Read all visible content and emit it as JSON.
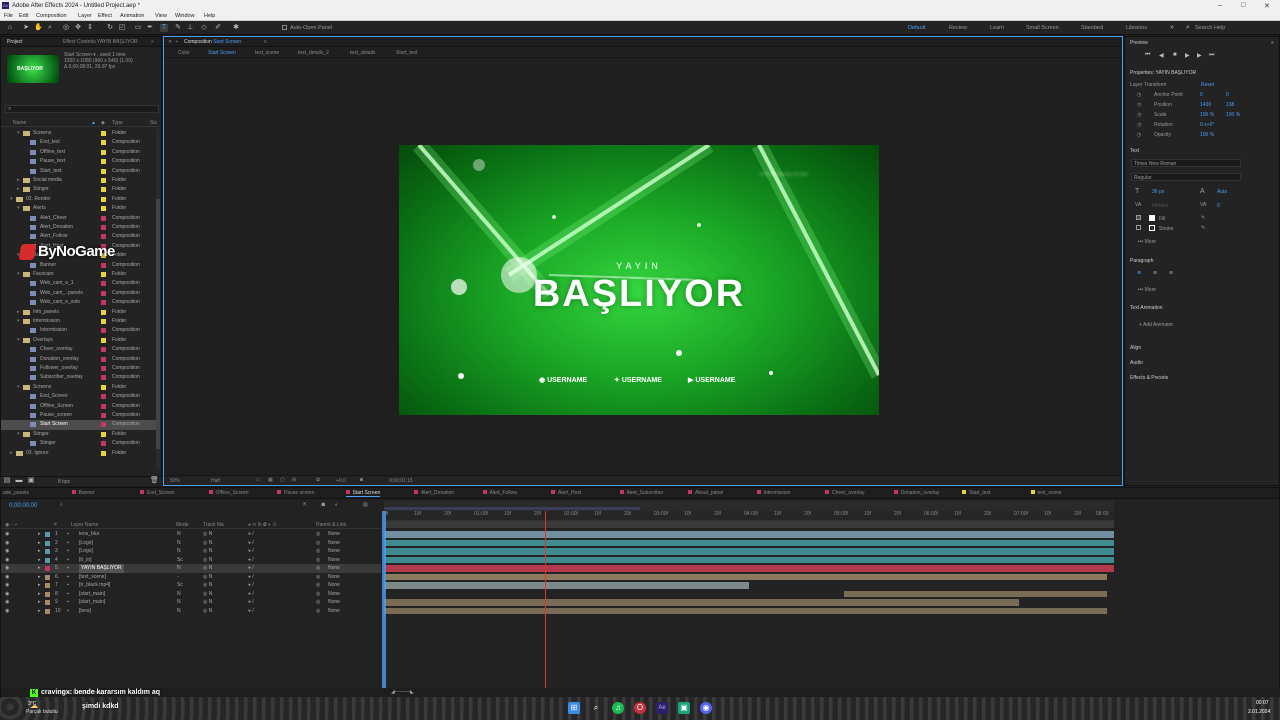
{
  "window": {
    "title": "Adobe After Effects 2024 - Untitled Project.aep *",
    "controls": [
      "–",
      "□",
      "✕"
    ]
  },
  "menu": [
    "File",
    "Edit",
    "Composition",
    "Layer",
    "Effect",
    "Animation",
    "View",
    "Window",
    "Help"
  ],
  "toolbar": {
    "auto_open": "Auto-Open Panel",
    "workspaces": [
      {
        "label": "Default",
        "active": true
      },
      {
        "label": "Review",
        "active": false
      },
      {
        "label": "Learn",
        "active": false
      },
      {
        "label": "Small Screen",
        "active": false
      },
      {
        "label": "Standard",
        "active": false
      },
      {
        "label": "Libraries",
        "active": false
      }
    ],
    "search_help": "Search Help"
  },
  "project": {
    "tabs": {
      "project": "Project",
      "effect_controls": "Effect Controls YAYIN BAŞLIYOR"
    },
    "thumb_text": "BAŞLIYOR",
    "info": [
      "Start Screen ▾ , used 1 time",
      "1920 x 1080 (960 x 540) (1.00)",
      "Δ 0;00;08;01, 29.97 fps"
    ],
    "columns": {
      "name": "Name",
      "type": "Type",
      "size": "Siz"
    },
    "rows": [
      {
        "indent": 2,
        "kind": "folder",
        "name": "Screens",
        "type": "Folder",
        "color": "#e7d33b",
        "open": true
      },
      {
        "indent": 3,
        "kind": "comp",
        "name": "End_text",
        "type": "Composition",
        "color": "#e7d33b"
      },
      {
        "indent": 3,
        "kind": "comp",
        "name": "Offline_text",
        "type": "Composition",
        "color": "#e7d33b"
      },
      {
        "indent": 3,
        "kind": "comp",
        "name": "Pause_text",
        "type": "Composition",
        "color": "#e7d33b"
      },
      {
        "indent": 3,
        "kind": "comp",
        "name": "Start_text",
        "type": "Composition",
        "color": "#e7d33b"
      },
      {
        "indent": 2,
        "kind": "folder",
        "name": "Social media",
        "type": "Folder",
        "color": "#e7d33b"
      },
      {
        "indent": 2,
        "kind": "folder",
        "name": "Stinger",
        "type": "Folder",
        "color": "#e7d33b"
      },
      {
        "indent": 1,
        "kind": "folder",
        "name": "02. Render",
        "type": "Folder",
        "color": "#e7d33b",
        "open": true
      },
      {
        "indent": 2,
        "kind": "folder",
        "name": "Alerts",
        "type": "Folder",
        "color": "#e7d33b",
        "open": true
      },
      {
        "indent": 3,
        "kind": "comp",
        "name": "Alert_Cheer",
        "type": "Composition",
        "color": "#c5356b"
      },
      {
        "indent": 3,
        "kind": "comp",
        "name": "Alert_Donation",
        "type": "Composition",
        "color": "#c5356b"
      },
      {
        "indent": 3,
        "kind": "comp",
        "name": "Alert_Follow",
        "type": "Composition",
        "color": "#c5356b"
      },
      {
        "indent": 3,
        "kind": "comp",
        "name": "Alert_Host",
        "type": "Composition",
        "color": "#c5356b"
      },
      {
        "indent": 2,
        "kind": "folder",
        "name": "Banner",
        "type": "Folder",
        "color": "#e7d33b",
        "open": true
      },
      {
        "indent": 3,
        "kind": "comp",
        "name": "Banner",
        "type": "Composition",
        "color": "#c5356b"
      },
      {
        "indent": 2,
        "kind": "folder",
        "name": "Facecam",
        "type": "Folder",
        "color": "#e7d33b",
        "open": true
      },
      {
        "indent": 3,
        "kind": "comp",
        "name": "Web_cam_e_1",
        "type": "Composition",
        "color": "#c5356b"
      },
      {
        "indent": 3,
        "kind": "comp",
        "name": "Web_cam_..panels",
        "type": "Composition",
        "color": "#c5356b"
      },
      {
        "indent": 3,
        "kind": "comp",
        "name": "Web_cam_e_solo",
        "type": "Composition",
        "color": "#c5356b"
      },
      {
        "indent": 2,
        "kind": "folder",
        "name": "Info_panels",
        "type": "Folder",
        "color": "#e7d33b"
      },
      {
        "indent": 2,
        "kind": "folder",
        "name": "Intermission",
        "type": "Folder",
        "color": "#e7d33b",
        "open": true
      },
      {
        "indent": 3,
        "kind": "comp",
        "name": "Intermission",
        "type": "Composition",
        "color": "#c5356b"
      },
      {
        "indent": 2,
        "kind": "folder",
        "name": "Overlays",
        "type": "Folder",
        "color": "#e7d33b",
        "open": true
      },
      {
        "indent": 3,
        "kind": "comp",
        "name": "Cheer_overlay",
        "type": "Composition",
        "color": "#c5356b"
      },
      {
        "indent": 3,
        "kind": "comp",
        "name": "Donation_overlay",
        "type": "Composition",
        "color": "#c5356b"
      },
      {
        "indent": 3,
        "kind": "comp",
        "name": "Follower_overlay",
        "type": "Composition",
        "color": "#c5356b"
      },
      {
        "indent": 3,
        "kind": "comp",
        "name": "Subscriber_overlay",
        "type": "Composition",
        "color": "#c5356b"
      },
      {
        "indent": 2,
        "kind": "folder",
        "name": "Screens",
        "type": "Folder",
        "color": "#e7d33b",
        "open": true
      },
      {
        "indent": 3,
        "kind": "comp",
        "name": "End_Screen",
        "type": "Composition",
        "color": "#c5356b"
      },
      {
        "indent": 3,
        "kind": "comp",
        "name": "Offline_Screen",
        "type": "Composition",
        "color": "#c5356b"
      },
      {
        "indent": 3,
        "kind": "comp",
        "name": "Pause_screen",
        "type": "Composition",
        "color": "#c5356b"
      },
      {
        "indent": 3,
        "kind": "comp",
        "name": "Start Screen",
        "type": "Composition",
        "color": "#c5356b",
        "selected": true
      },
      {
        "indent": 2,
        "kind": "folder",
        "name": "Stinger",
        "type": "Folder",
        "color": "#e7d33b",
        "open": true
      },
      {
        "indent": 3,
        "kind": "comp",
        "name": "Stinger",
        "type": "Composition",
        "color": "#c5356b"
      },
      {
        "indent": 1,
        "kind": "folder",
        "name": "03. Ignore",
        "type": "Folder",
        "color": "#e7d33b"
      }
    ],
    "bpc": "8 bpc"
  },
  "watermark": "ByNoGame",
  "composition": {
    "tab_label": "Composition",
    "tab_name": "Start Screen",
    "breadcrumbs": [
      "Color",
      "Start Screen",
      "text_scene",
      "text_details_2",
      "text_details",
      "Start_text"
    ],
    "preview": {
      "subtitle": "YAYIN",
      "title": "BAŞLIYOR",
      "socials": [
        "USERNAME",
        "USERNAME",
        "USERNAME"
      ],
      "corner_blur": "YAYIN BAŞLIYOR"
    },
    "footer": {
      "zoom": "50%",
      "resolution": "Half",
      "exposure": "+0.0",
      "timecode": "0;00;01;15"
    }
  },
  "right_panel": {
    "preview_label": "Preview",
    "properties_title": "Properties: YAYIN BAŞLIYOR",
    "layer_transform": "Layer Transform",
    "reset": "Reset",
    "transform": [
      {
        "label": "Anchor Point",
        "v1": "0",
        "v2": "0"
      },
      {
        "label": "Position",
        "v1": "1430",
        "v2": "138"
      },
      {
        "label": "Scale",
        "v1": "100 %",
        "v2": "100 %"
      },
      {
        "label": "Rotation",
        "v1": "0 x+0°",
        "v2": ""
      },
      {
        "label": "Opacity",
        "v1": "100 %",
        "v2": ""
      }
    ],
    "text_section": "Text",
    "font": "Times New Roman",
    "font_style": "Regular",
    "font_size": "36 px",
    "leading": "Auto",
    "kerning": "Metrics",
    "tracking": "0",
    "fill": "Fill",
    "stroke": "Stroke",
    "more": "More",
    "paragraph": "Paragraph",
    "text_animation": "Text Animation",
    "add_animator": "Add Animator",
    "align": "Align",
    "audio": "Audio",
    "effects_presets": "Effects & Presets"
  },
  "timeline": {
    "tabs": [
      {
        "label": "ade_panels",
        "color": "#999"
      },
      {
        "label": "Banner",
        "color": "#c5356b"
      },
      {
        "label": "End_Screen",
        "color": "#c5356b"
      },
      {
        "label": "Offline_Screen",
        "color": "#c5356b"
      },
      {
        "label": "Pause screen",
        "color": "#c5356b"
      },
      {
        "label": "Start Screen",
        "color": "#c5356b",
        "active": true
      },
      {
        "label": "Alert_Donation",
        "color": "#c5356b"
      },
      {
        "label": "Alert_Follow",
        "color": "#c5356b"
      },
      {
        "label": "Alert_Host",
        "color": "#c5356b"
      },
      {
        "label": "Alert_Subscriber",
        "color": "#c5356b"
      },
      {
        "label": "About_panel",
        "color": "#c5356b"
      },
      {
        "label": "Intermission",
        "color": "#c5356b"
      },
      {
        "label": "Cheer_overlay",
        "color": "#c5356b"
      },
      {
        "label": "Donation_overlay",
        "color": "#c5356b"
      },
      {
        "label": "Start_text",
        "color": "#e7d33b"
      },
      {
        "label": "text_scene",
        "color": "#e7d33b"
      }
    ],
    "timecode": "0;00;00;00",
    "col_headers": {
      "num": "#",
      "layer": "Layer Name",
      "mode": "Mode",
      "trkmat": "Track Ma",
      "parent": "Parent & Link"
    },
    "ruler": [
      "0f",
      "10f",
      "20f",
      "01:00f",
      "10f",
      "20f",
      "02:00f",
      "10f",
      "20f",
      "03:00f",
      "10f",
      "20f",
      "04:00f",
      "10f",
      "20f",
      "05:00f",
      "10f",
      "20f",
      "06:00f",
      "10f",
      "20f",
      "07:00f",
      "10f",
      "20f",
      "08:00"
    ],
    "layers": [
      {
        "num": "1",
        "name": "lens_blur",
        "mode": "N",
        "parent": "None",
        "color": "#5c9aa6",
        "bar_color": "#6f8f9e",
        "start": 0.0,
        "end": 1.0
      },
      {
        "num": "2",
        "name": "[Logo]",
        "mode": "N",
        "parent": "None",
        "color": "#5c9aa6",
        "bar_color": "#3f8b8f",
        "start": 0.0,
        "end": 1.0
      },
      {
        "num": "3",
        "name": "[Logo]",
        "mode": "N",
        "parent": "None",
        "color": "#5c9aa6",
        "bar_color": "#3f8b8f",
        "start": 0.0,
        "end": 1.0
      },
      {
        "num": "4",
        "name": "[tr_in]",
        "mode": "Sc",
        "parent": "None",
        "color": "#5c9aa6",
        "bar_color": "#3f8b8f",
        "start": 0.0,
        "end": 1.0
      },
      {
        "num": "5",
        "name": "YAYIN BAŞLIYOR",
        "mode": "N",
        "parent": "None",
        "color": "#c5356b",
        "bar_color": "#b33a4c",
        "start": 0.0,
        "end": 1.0,
        "selected": true
      },
      {
        "num": "6",
        "name": "[text_scene]",
        "mode": "-",
        "parent": "None",
        "color": "#a38a6a",
        "bar_color": "#8d7a5e",
        "start": 0.0,
        "end": 0.99
      },
      {
        "num": "7",
        "name": "[tr_black.mp4]",
        "mode": "Sc",
        "parent": "None",
        "color": "#a38a6a",
        "bar_color": "#7d8a8a",
        "start": 0.0,
        "end": 0.5
      },
      {
        "num": "8",
        "name": "[start_main]",
        "mode": "N",
        "parent": "None",
        "color": "#a38a6a",
        "bar_color": "#7a6b57",
        "start": 0.63,
        "end": 0.99
      },
      {
        "num": "9",
        "name": "[start_main]",
        "mode": "N",
        "parent": "None",
        "color": "#a38a6a",
        "bar_color": "#7a6b57",
        "start": 0.0,
        "end": 0.87
      },
      {
        "num": "10",
        "name": "[lens]",
        "mode": "N",
        "parent": "None",
        "color": "#a38a6a",
        "bar_color": "#7a6b57",
        "start": 0.0,
        "end": 0.99
      }
    ],
    "playhead_fraction": 0.22,
    "work_area_fraction": 0.35,
    "footer": "Frame Render Time"
  },
  "chat": {
    "lines": [
      "cravingx: bende kararsım kaldım aq",
      "şimdi kdkd"
    ],
    "weather": {
      "temp": "3°C",
      "desc": "Parçalı bulutlu"
    }
  },
  "taskbar": {
    "time": "00:07",
    "date": "2.01.2024"
  }
}
